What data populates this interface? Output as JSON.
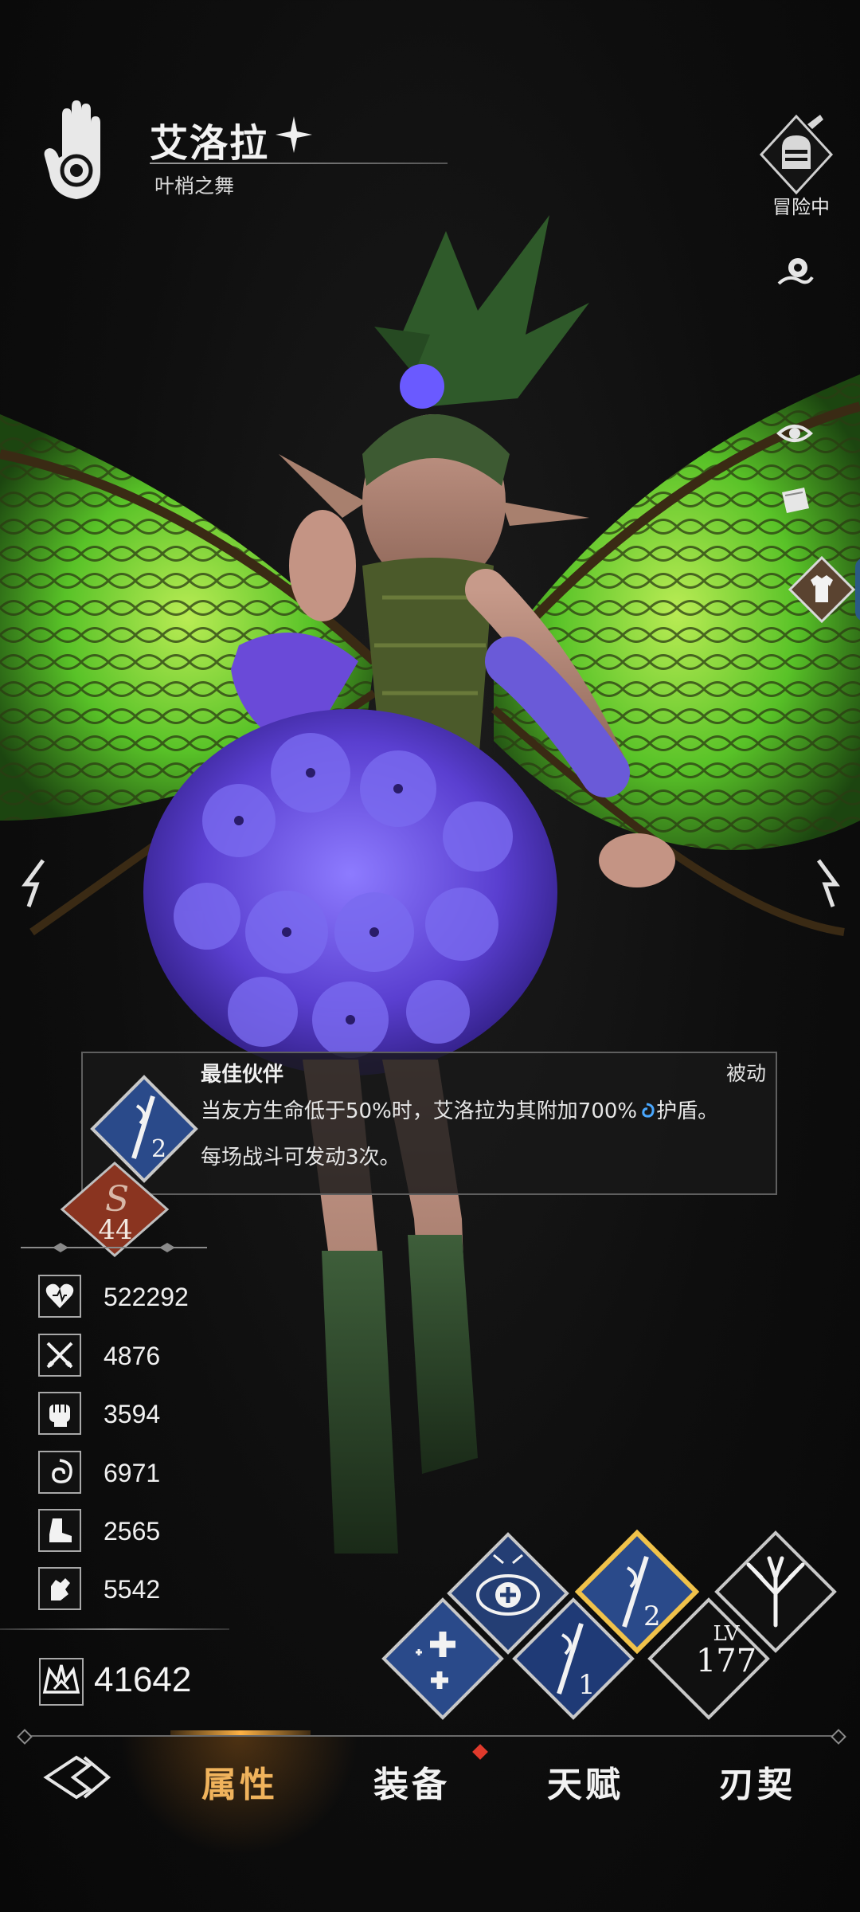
{
  "header": {
    "name": "艾洛拉",
    "title": "叶梢之舞",
    "status": "冒险中"
  },
  "icons": {
    "class_emblem": "hand-emblem-icon",
    "status_badge": "knight-helmet-icon",
    "side_actions": [
      "camera-icon",
      "eye-icon",
      "card-icon",
      "outfit-icon"
    ],
    "nav_back": "back-emblem-icon"
  },
  "tooltip": {
    "skill_name": "最佳伙伴",
    "type": "被动",
    "line1_before": "当友方生命低于50%时，艾洛拉为其附加700%",
    "line1_after": "护盾。",
    "line2": "每场战斗可发动3次。",
    "skill_icon_number": "2"
  },
  "rank": {
    "letter": "S",
    "number": "44",
    "color": "#8a3420"
  },
  "stats": [
    {
      "icon": "heart-icon",
      "value": "522292"
    },
    {
      "icon": "crossed-swords-icon",
      "value": "4876"
    },
    {
      "icon": "fist-icon",
      "value": "3594"
    },
    {
      "icon": "swirl-icon",
      "value": "6971"
    },
    {
      "icon": "boot-icon",
      "value": "2565"
    },
    {
      "icon": "gauntlet-icon",
      "value": "5542"
    }
  ],
  "power": {
    "icon": "power-crown-icon",
    "value": "41642"
  },
  "skills": [
    {
      "name": "heal-skill",
      "label": ""
    },
    {
      "name": "passive-2-skill",
      "label": "2",
      "selected": true
    },
    {
      "name": "tree-skill",
      "label": ""
    },
    {
      "name": "buff-skill",
      "label": ""
    },
    {
      "name": "passive-1-skill",
      "label": "1"
    }
  ],
  "level": {
    "label": "LV",
    "value": "177"
  },
  "nav": {
    "tabs": [
      "属性",
      "装备",
      "天赋",
      "刃契"
    ],
    "active": 0,
    "accent": "#f0b35c",
    "notification_color": "#e03a2c"
  }
}
